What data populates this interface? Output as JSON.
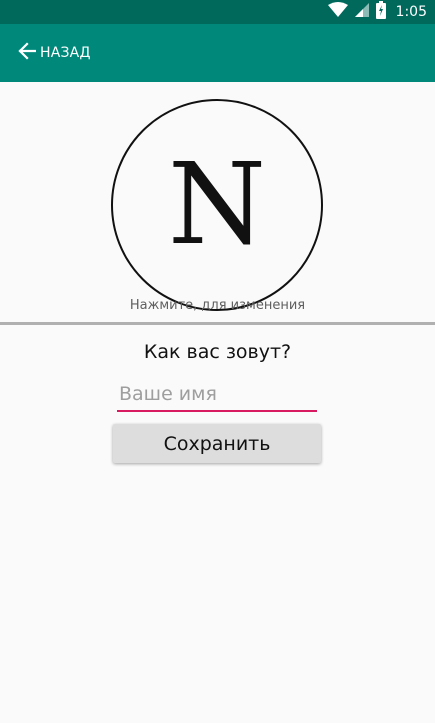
{
  "status_bar": {
    "time": "1:05",
    "icons": [
      "wifi-icon",
      "cell-signal-icon",
      "battery-icon"
    ],
    "background": "#00695c"
  },
  "app_bar": {
    "back_label": "НАЗАД",
    "back_icon": "arrow-left-icon",
    "background": "#00897b"
  },
  "avatar": {
    "letter": "N",
    "hint": "Нажмите, для изменения"
  },
  "form": {
    "question": "Как вас зовут?",
    "name_value": "",
    "name_placeholder": "Ваше имя",
    "save_label": "Сохранить",
    "accent": "#d81b60"
  }
}
